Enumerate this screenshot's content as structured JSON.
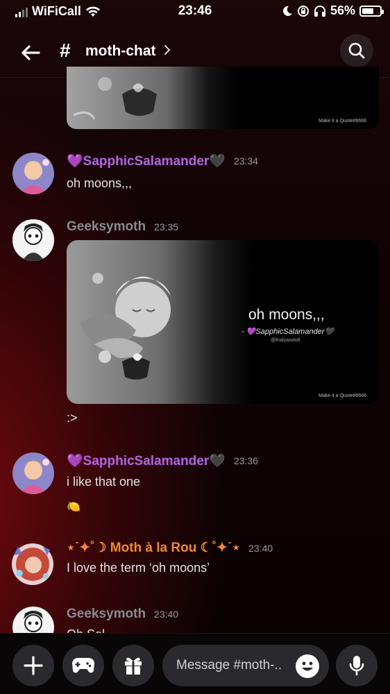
{
  "status_bar": {
    "carrier": "WiFiCall",
    "time": "23:46",
    "battery": "56%",
    "battery_level": 0.56,
    "icons": [
      "signal-icon",
      "wifi-icon",
      "moon-icon",
      "lock-rotation-icon",
      "headphones-icon",
      "battery-icon"
    ]
  },
  "header": {
    "hash": "#",
    "channel": "moth-chat",
    "chevron": "›",
    "icons": [
      "back-arrow-icon",
      "search-icon"
    ]
  },
  "messages": [
    {
      "author": "💜SapphicSalamander🖤",
      "author_color": "#b565e8",
      "time": "23:34",
      "text": "oh moons,,,"
    },
    {
      "author": "Geeksymoth",
      "author_color": "#8a8a92",
      "time": "23:35",
      "text": ":>"
    },
    {
      "author": "💜SapphicSalamander🖤",
      "author_color": "#b565e8",
      "time": "23:36",
      "text": "i like that one",
      "emoji": "🍋"
    },
    {
      "author": "⋆˙✦˚☽ Moth à la Rou ☾˚✦˙⋆",
      "author_color": "#f08a30",
      "time": "23:40",
      "text": "I love the term ‘oh moons’"
    },
    {
      "author": "Geeksymoth",
      "author_color": "#8a8a92",
      "time": "23:40",
      "text": "Oh Sal"
    }
  ],
  "quote_top": {
    "watermark": "Make it a Quote#6666"
  },
  "quote_card": {
    "text": "oh moons,,,",
    "author": "- 💜SapphicSalamander🖤",
    "handle": "@fruityaxolotl",
    "watermark": "Make it a Quote#6666"
  },
  "bottom_bar": {
    "placeholder": "Message #moth-..",
    "icons": [
      "plus-icon",
      "gamepad-icon",
      "gift-icon",
      "emoji-icon",
      "microphone-icon"
    ]
  }
}
